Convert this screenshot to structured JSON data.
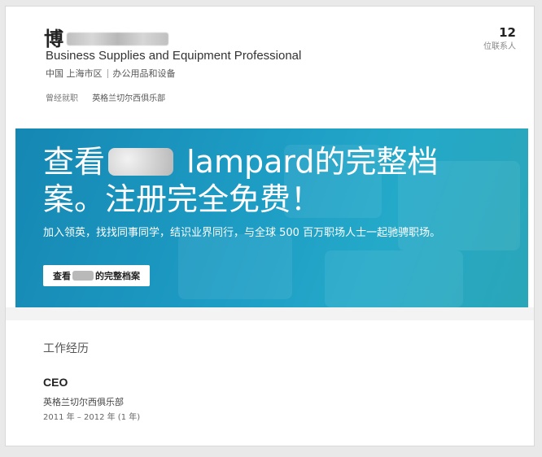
{
  "profile": {
    "name_visible": "博",
    "headline": "Business Supplies and Equipment Professional",
    "country": "中国 上海市区",
    "industry": "办公用品和设备",
    "previous_label": "曾经就职",
    "previous_company": "英格兰切尔西俱乐部",
    "connections_count": "12",
    "connections_label": "位联系人"
  },
  "banner": {
    "title_prefix": "查看",
    "title_suffix": " lampard的完整档案。注册完全免费！",
    "subtitle": "加入领英，找找同事同学，结识业界同行，与全球 500 百万职场人士一起驰骋职场。",
    "button_prefix": "查看",
    "button_suffix": "的完整档案"
  },
  "experience": {
    "section_title": "工作经历",
    "job_title": "CEO",
    "company": "英格兰切尔西俱乐部",
    "dates": "2011 年 – 2012 年 (1 年)"
  },
  "colors": {
    "banner_start": "#1587b3",
    "banner_end": "#2aa6b8"
  }
}
